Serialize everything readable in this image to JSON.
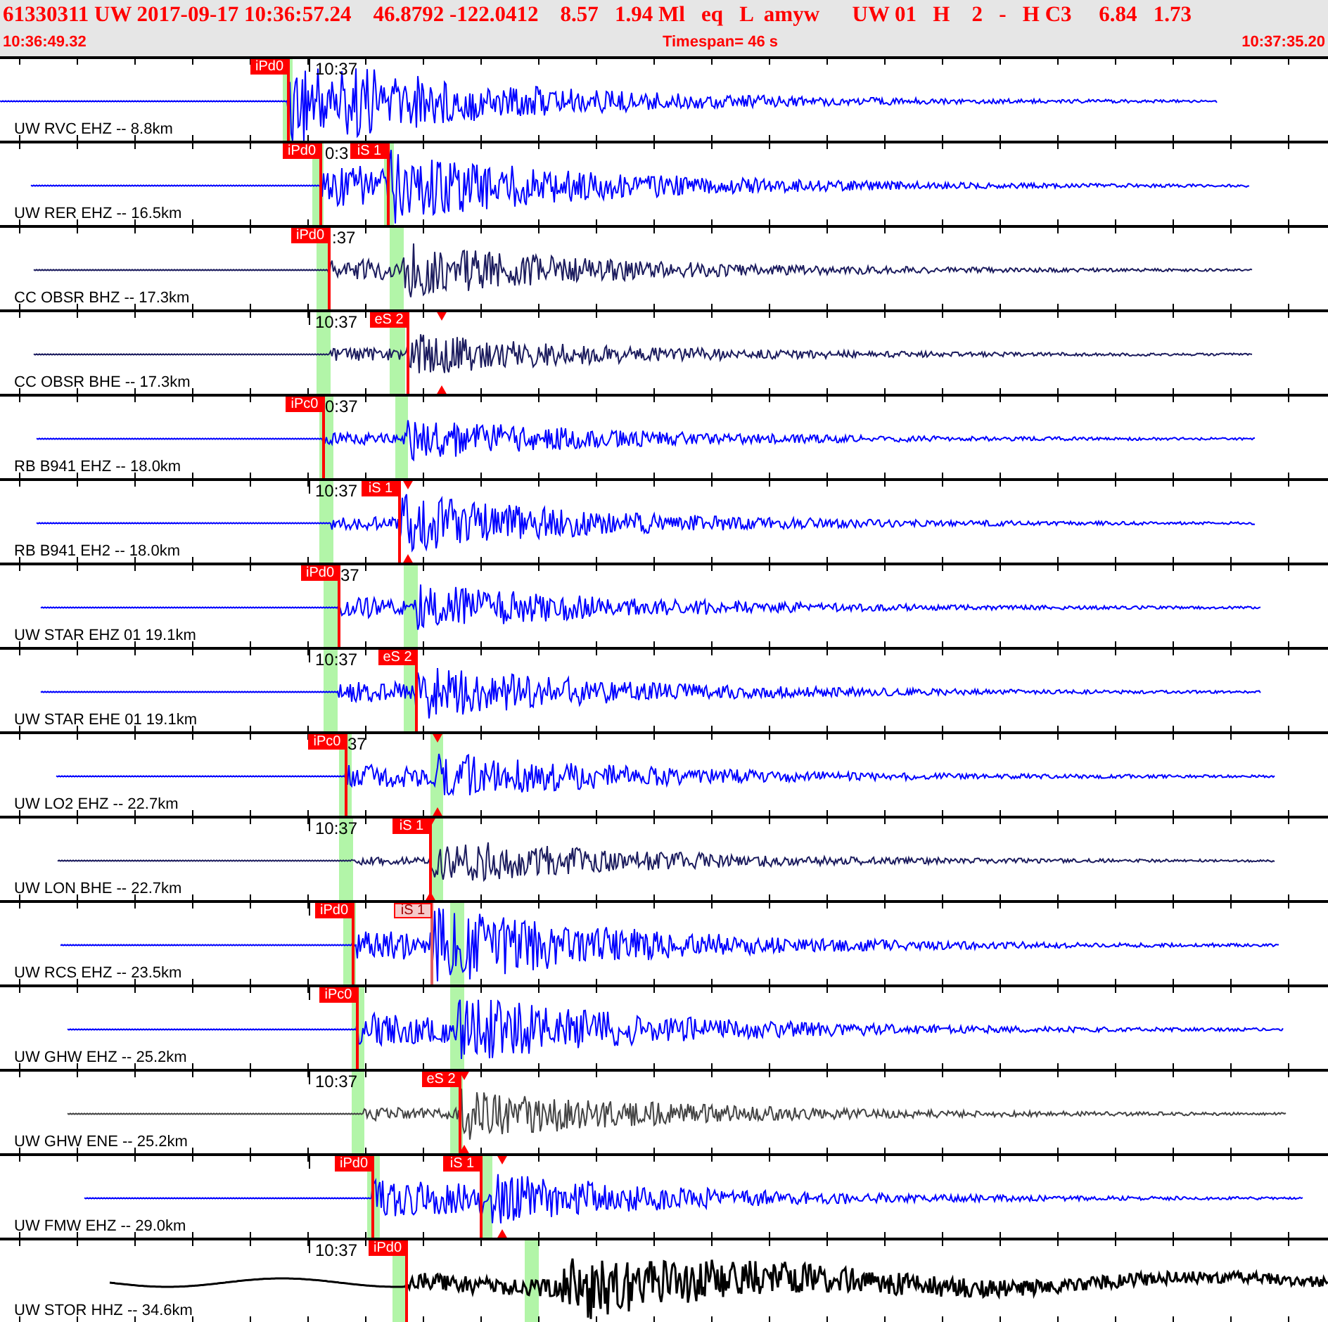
{
  "header": {
    "event": "61330311 UW 2017-09-17 10:36:57.24    46.8792 -122.0412    8.57   1.94 Ml   eq   L  amyw      UW 01   H    2   -   H C3     6.84   1.73",
    "start_time": "10:36:49.32",
    "timespan": "Timespan=  46 s",
    "end_time": "10:37:35.20"
  },
  "traces": [
    {
      "label": "UW RVC EHZ -- 8.8km",
      "color": "#0000ff",
      "time_label": "10:37",
      "picks": [
        {
          "label": "iPd0",
          "active": true
        }
      ]
    },
    {
      "label": "UW RER EHZ -- 16.5km",
      "color": "#0000ff",
      "time_label": "0:3",
      "picks": [
        {
          "label": "iPd0",
          "active": true
        },
        {
          "label": "iS 1",
          "active": true
        }
      ]
    },
    {
      "label": "CC OBSR BHZ -- 17.3km",
      "color": "#1c1c5e",
      "time_label": ":37",
      "picks": [
        {
          "label": "iPd0",
          "active": true
        }
      ]
    },
    {
      "label": "CC OBSR BHE -- 17.3km",
      "color": "#1c1c5e",
      "time_label": "10:37",
      "picks": [
        {
          "label": "eS 2",
          "active": true
        }
      ]
    },
    {
      "label": "RB B941 EHZ -- 18.0km",
      "color": "#0000ff",
      "time_label": "0:37",
      "picks": [
        {
          "label": "iPc0",
          "active": true
        }
      ]
    },
    {
      "label": "RB B941 EH2 -- 18.0km",
      "color": "#0000ff",
      "time_label": "10:37",
      "picks": [
        {
          "label": "iS 1",
          "active": true
        }
      ]
    },
    {
      "label": "UW STAR EHZ 01 19.1km",
      "color": "#0000ff",
      "time_label": "37",
      "picks": [
        {
          "label": "iPd0",
          "active": true
        }
      ]
    },
    {
      "label": "UW STAR EHE 01 19.1km",
      "color": "#0000ff",
      "time_label": "10:37",
      "picks": [
        {
          "label": "eS 2",
          "active": true
        }
      ]
    },
    {
      "label": "UW LO2 EHZ -- 22.7km",
      "color": "#0000ff",
      "time_label": "37",
      "picks": [
        {
          "label": "iPc0",
          "active": true
        }
      ]
    },
    {
      "label": "UW LON BHE -- 22.7km",
      "color": "#1c1c5e",
      "time_label": "10:37",
      "picks": [
        {
          "label": "iS 1",
          "active": true
        }
      ]
    },
    {
      "label": "UW RCS EHZ -- 23.5km",
      "color": "#0000ff",
      "picks": [
        {
          "label": "iPd0",
          "active": true
        },
        {
          "label": "iS 1",
          "active": false
        }
      ]
    },
    {
      "label": "UW GHW EHZ -- 25.2km",
      "color": "#0000ff",
      "picks": [
        {
          "label": "iPc0",
          "active": true
        }
      ]
    },
    {
      "label": "UW GHW ENE -- 25.2km",
      "color": "#444444",
      "time_label": "10:37",
      "picks": [
        {
          "label": "eS 2",
          "active": true
        }
      ]
    },
    {
      "label": "UW FMW EHZ -- 29.0km",
      "color": "#0000ff",
      "picks": [
        {
          "label": "iPd0",
          "active": true
        },
        {
          "label": "iS 1",
          "active": true
        }
      ]
    },
    {
      "label": "UW STOR HHZ -- 34.6km",
      "color": "#000000",
      "time_label": "10:37",
      "picks": [
        {
          "label": "iPd0",
          "active": true
        }
      ]
    }
  ]
}
